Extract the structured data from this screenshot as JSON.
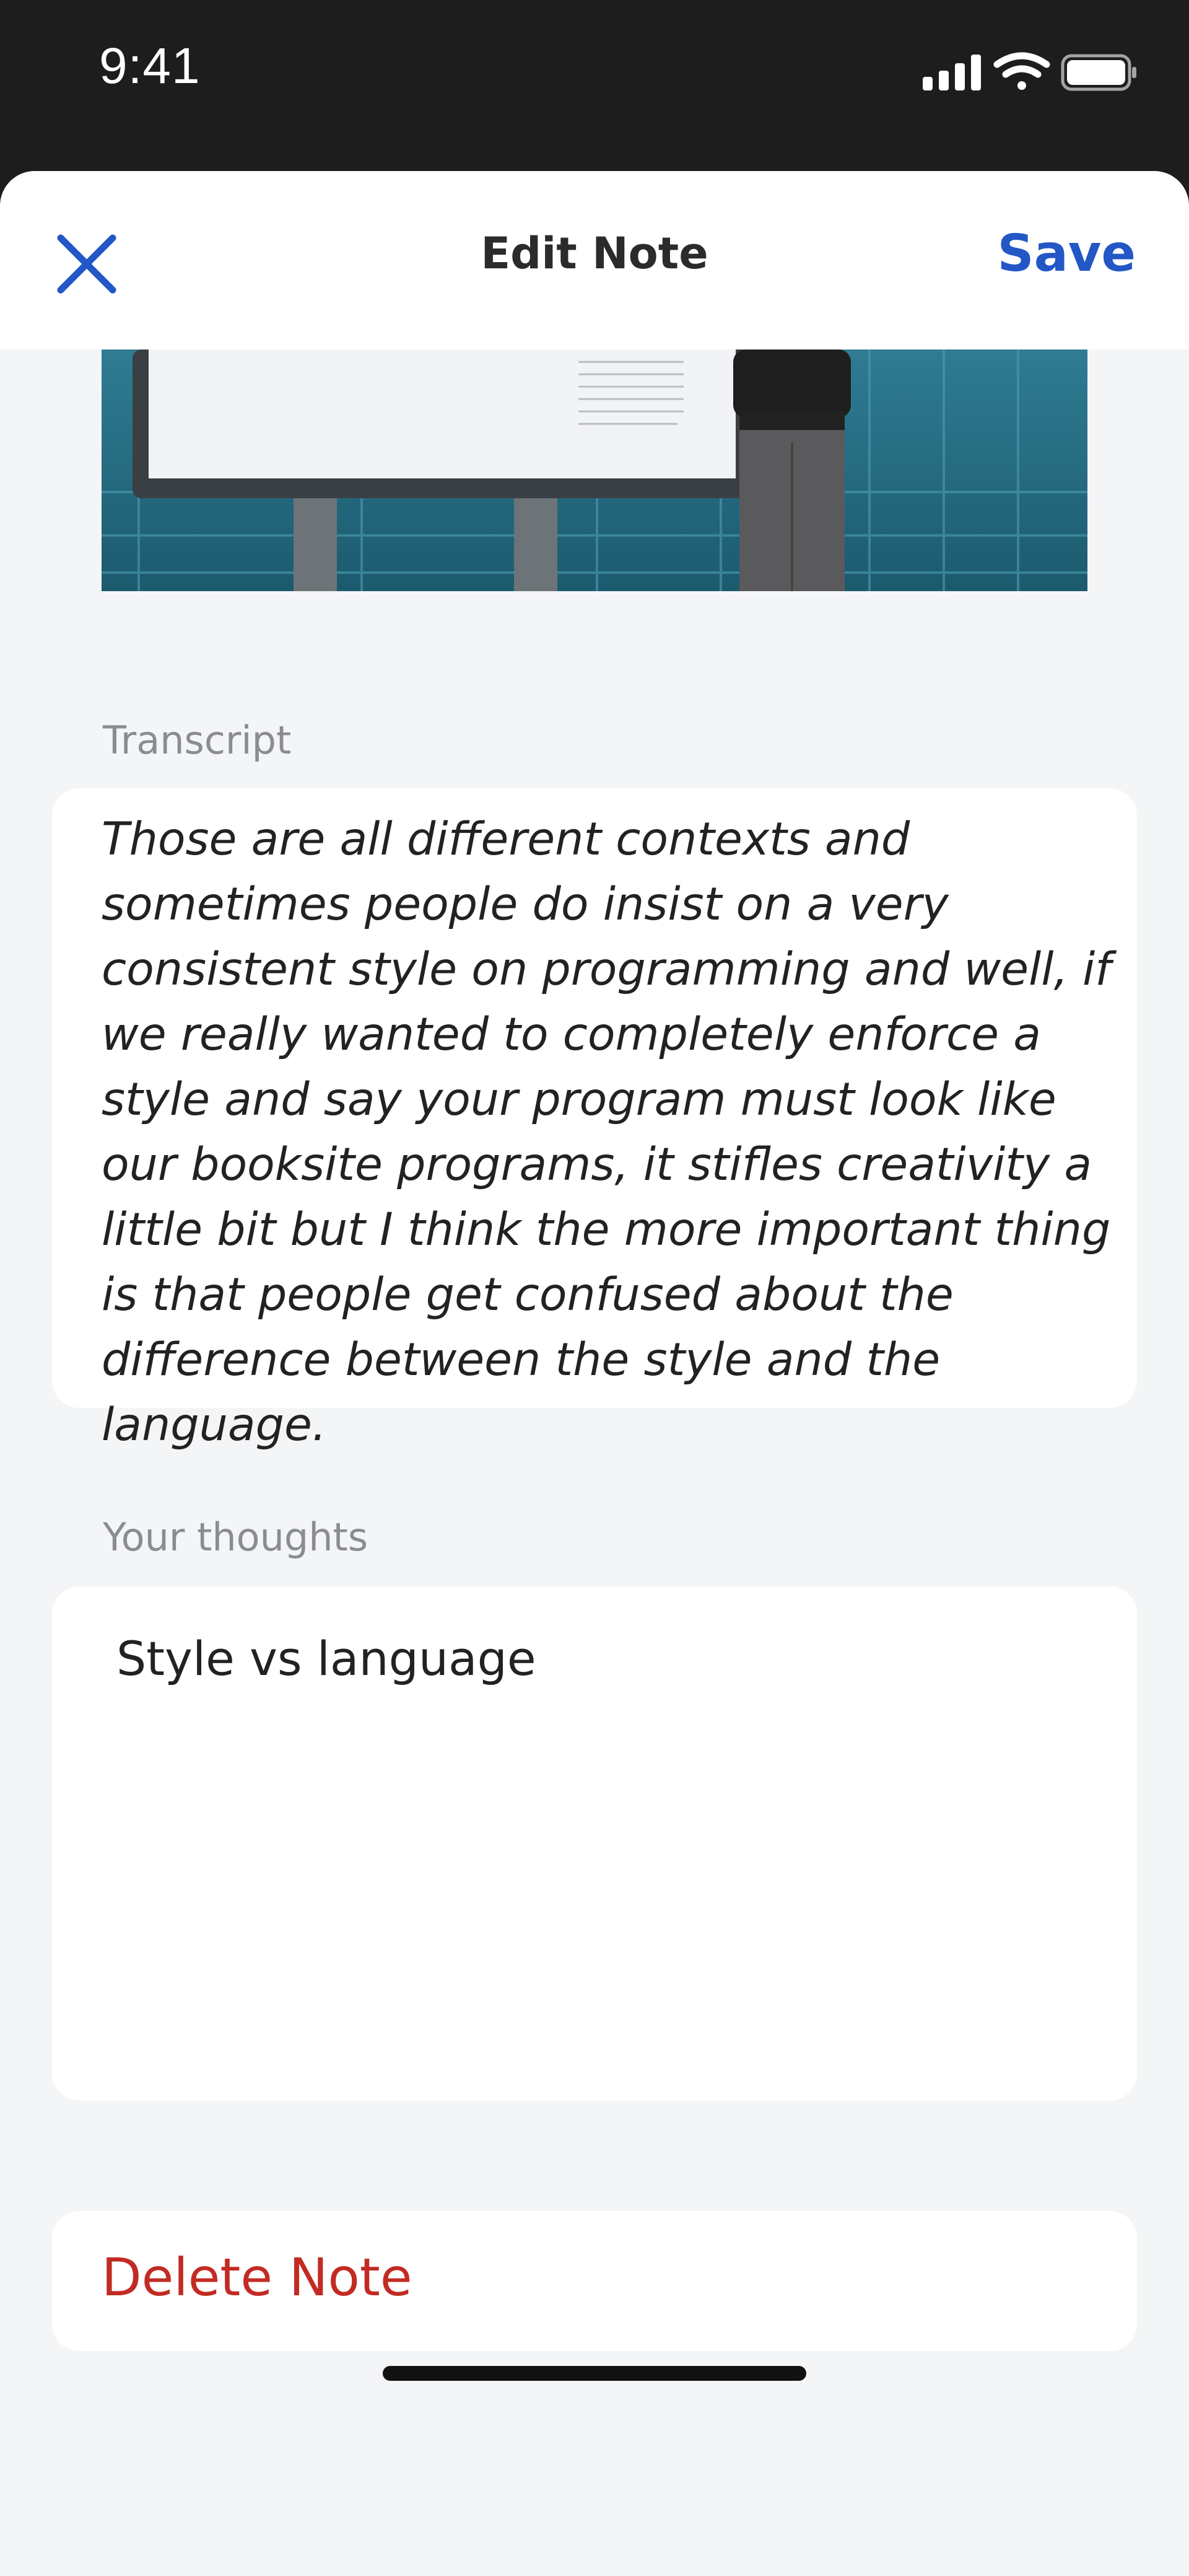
{
  "status_bar": {
    "time": "9:41",
    "icons": [
      "cellular-signal-icon",
      "wifi-icon",
      "battery-icon"
    ]
  },
  "nav": {
    "close_icon": "close-icon",
    "title": "Edit Note",
    "save_label": "Save"
  },
  "video": {
    "thumbnail": "lecture-video-frame"
  },
  "transcript": {
    "label": "Transcript",
    "text": "Those are all different contexts and sometimes people do insist on a very consistent style on programming and well, if we really wanted to completely enforce a style and say your program must look like our booksite programs, it stifles creativity a little bit but I think the more important thing is that people get confused about the difference between the style and the language."
  },
  "thoughts": {
    "label": "Your thoughts",
    "value": "Style vs language"
  },
  "delete": {
    "label": "Delete Note"
  },
  "colors": {
    "accent": "#2257c5",
    "destructive": "#c22b23",
    "background": "#f4f5f7",
    "status_bar": "#1d1d1d"
  }
}
